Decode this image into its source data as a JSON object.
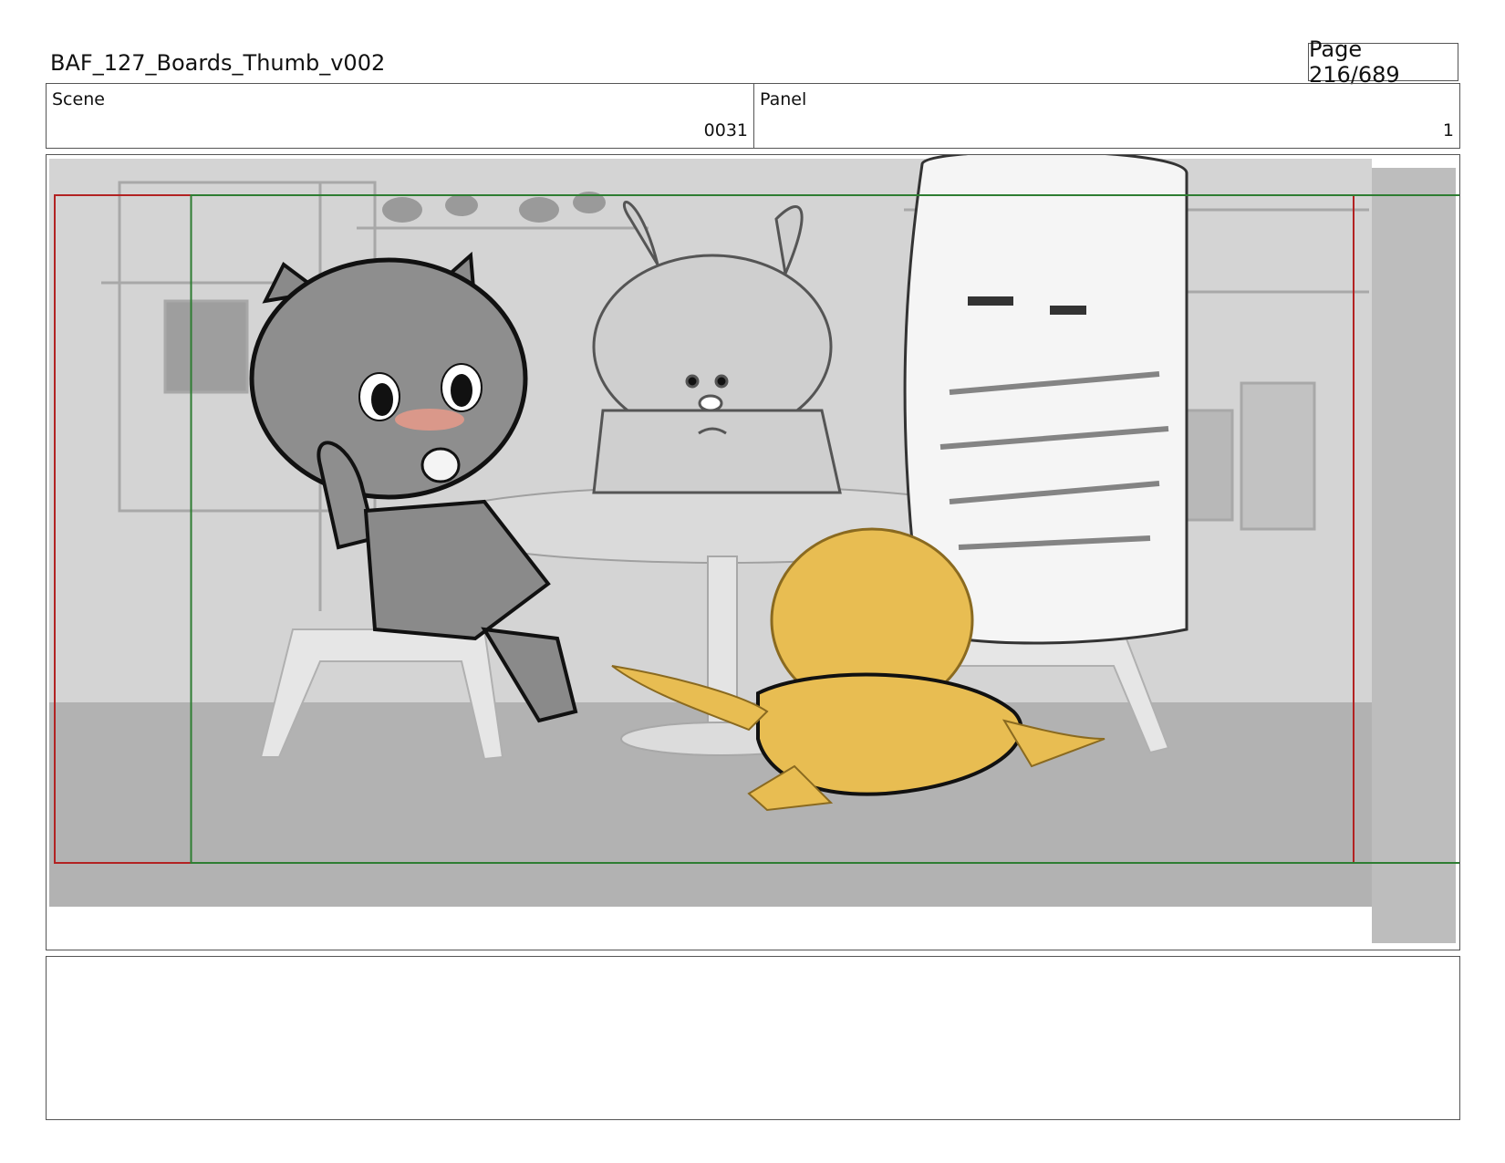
{
  "header": {
    "title": "BAF_127_Boards_Thumb_v002",
    "page": "Page 216/689"
  },
  "scene": {
    "label": "Scene",
    "value": "0031"
  },
  "panel": {
    "label": "Panel",
    "value": "1"
  },
  "colors": {
    "safe_frame": "#b22222",
    "action_frame": "#2e7d32",
    "character_yellow": "#e8bd52",
    "background_gray": "#c9c9c9"
  },
  "notes": {
    "text": ""
  }
}
